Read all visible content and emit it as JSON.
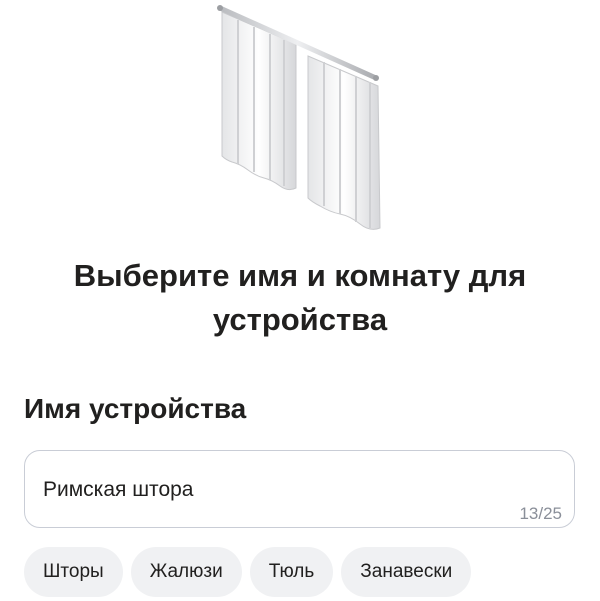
{
  "illustration": {
    "icon": "curtain-icon"
  },
  "heading": {
    "line1": "Выберите имя и комнату для",
    "line2": "устройства"
  },
  "device_name": {
    "label": "Имя устройства",
    "value": "Римская штора",
    "counter": "13/25"
  },
  "suggestions": [
    {
      "label": "Шторы"
    },
    {
      "label": "Жалюзи"
    },
    {
      "label": "Тюль"
    },
    {
      "label": "Занавески"
    }
  ],
  "colors": {
    "text": "#21201f",
    "field_border": "#c9cdd6",
    "chip_background": "#f0f1f3",
    "counter_text": "#8a8f99"
  }
}
